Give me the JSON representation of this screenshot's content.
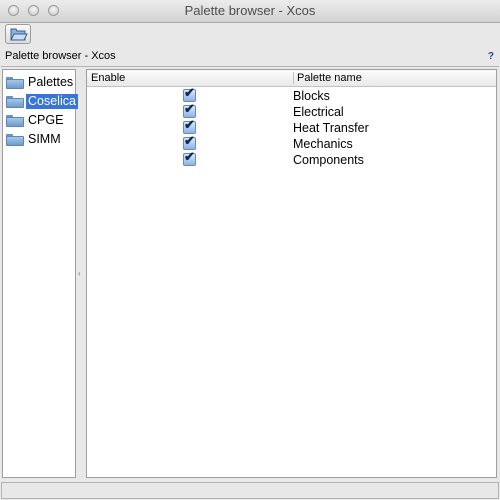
{
  "window": {
    "title": "Palette browser - Xcos"
  },
  "toolbar": {
    "open_icon": "folder-open-icon"
  },
  "subheader": {
    "title": "Palette browser - Xcos",
    "help_label": "?"
  },
  "tree": {
    "items": [
      {
        "label": "Palettes",
        "icon": "folder-icon",
        "selected": false
      },
      {
        "label": "Coselica",
        "icon": "folder-icon",
        "selected": true
      },
      {
        "label": "CPGE",
        "icon": "folder-icon",
        "selected": false
      },
      {
        "label": "SIMM",
        "icon": "folder-icon",
        "selected": false
      }
    ]
  },
  "divider": {
    "grip": "‹"
  },
  "table": {
    "columns": [
      "Enable",
      "Palette name"
    ],
    "rows": [
      {
        "enabled": true,
        "name": "Blocks"
      },
      {
        "enabled": true,
        "name": "Electrical"
      },
      {
        "enabled": true,
        "name": "Heat Transfer"
      },
      {
        "enabled": true,
        "name": "Mechanics"
      },
      {
        "enabled": true,
        "name": "Components"
      }
    ]
  },
  "colors": {
    "selection": "#3875d7",
    "help": "#2a3ea8"
  }
}
